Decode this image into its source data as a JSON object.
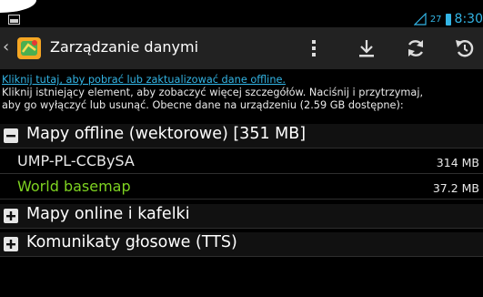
{
  "status_bar": {
    "battery": "27",
    "time": "8:30"
  },
  "action_bar": {
    "title": "Zarządzanie danymi",
    "icons": [
      "overflow-menu-icon",
      "download-icon",
      "refresh-icon",
      "undo-icon"
    ]
  },
  "info": {
    "link": "Kliknij tutaj, aby pobrać lub zaktualizować dane offline.",
    "line1": "Kliknij istniejący element, aby zobaczyć więcej szczegółów. Naciśnij i przytrzymaj,",
    "line2": "aby go wyłączyć lub usunąć. Obecne dane na urządzeniu (2.59 GB dostępne):"
  },
  "groups": [
    {
      "label": "Mapy offline (wektorowe) [351 MB]",
      "expanded": true,
      "items": [
        {
          "name": "UMP-PL-CCBySA",
          "size": "314 MB",
          "color": "#e8e8e8"
        },
        {
          "name": "World basemap",
          "size": "37.2 MB",
          "color": "#7ed321"
        }
      ]
    },
    {
      "label": "Mapy online i kafelki",
      "expanded": false
    },
    {
      "label": "Komunikaty głosowe (TTS)",
      "expanded": false
    }
  ],
  "colors": {
    "accent": "#33b5e5",
    "active_item": "#7ed321",
    "actionbar_bg": "#222222"
  }
}
